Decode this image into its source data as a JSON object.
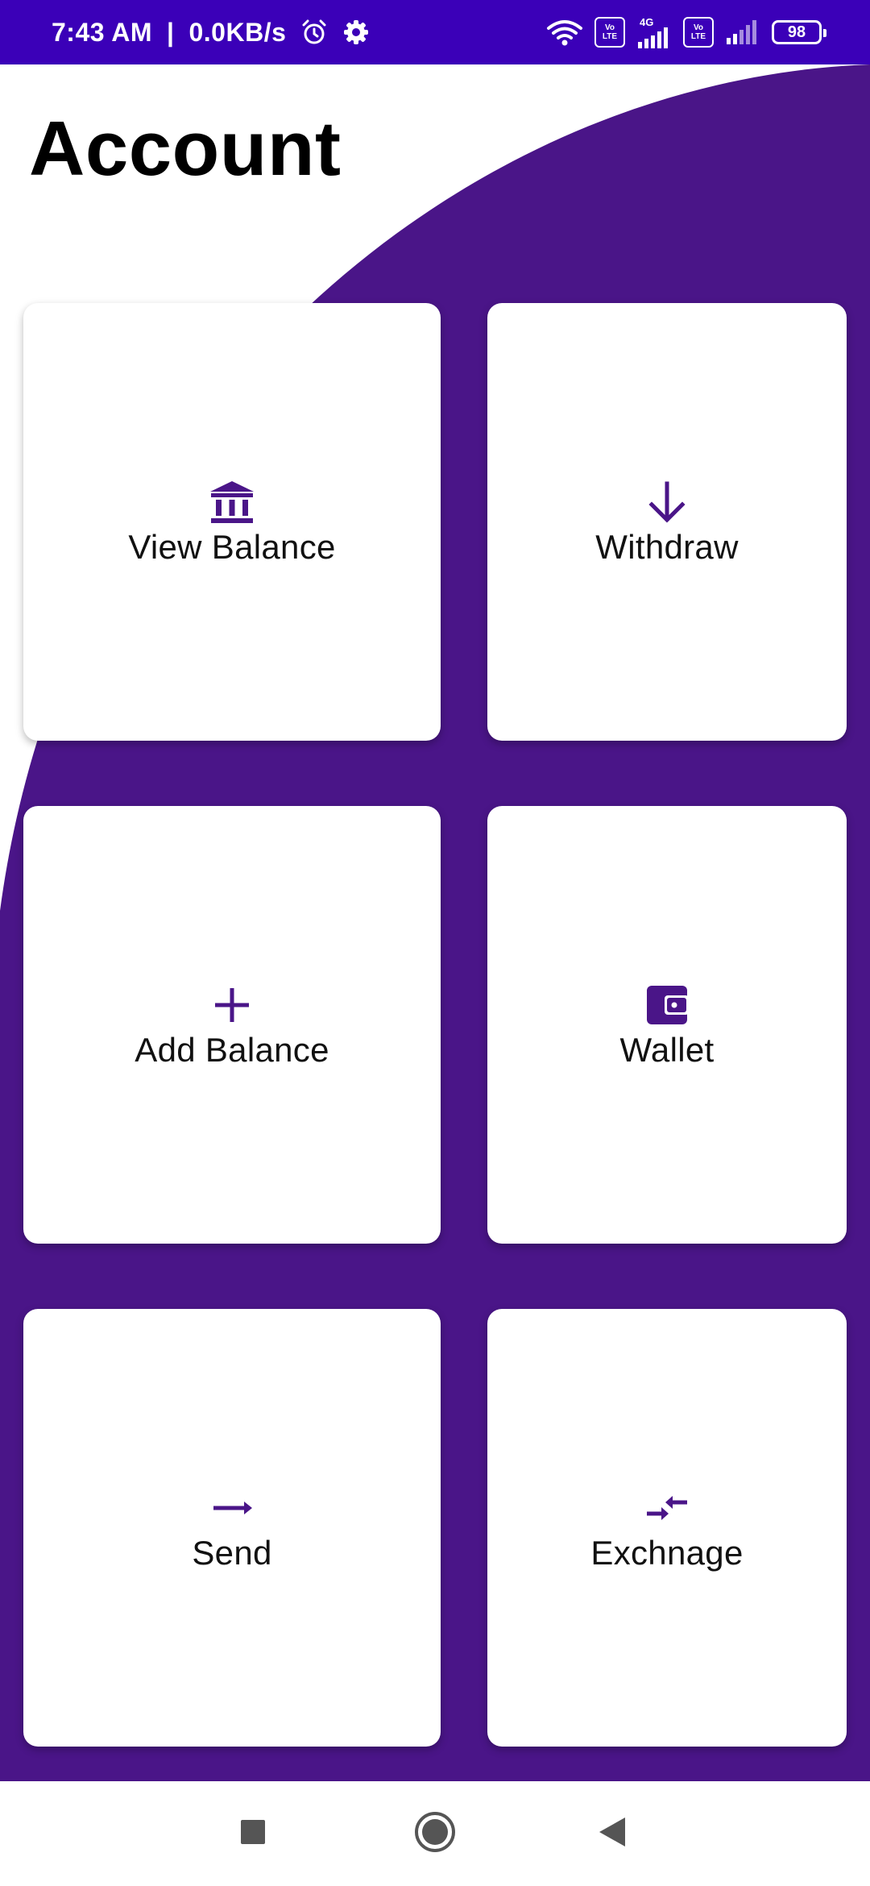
{
  "status_bar": {
    "time": "7:43 AM",
    "separator": "|",
    "net_speed": "0.0KB/s",
    "icons": [
      "alarm-icon",
      "gear-icon",
      "wifi-icon",
      "volte-icon",
      "signal-4g-icon",
      "volte-icon",
      "signal-icon",
      "battery-icon"
    ],
    "volte_top": "Vo",
    "volte_bottom": "LTE",
    "network_type": "4G",
    "battery_level": "98"
  },
  "page": {
    "title": "Account"
  },
  "tiles": [
    {
      "label": "View Balance",
      "icon": "bank-icon"
    },
    {
      "label": "Withdraw",
      "icon": "arrow-down-icon"
    },
    {
      "label": "Add Balance",
      "icon": "plus-icon"
    },
    {
      "label": "Wallet",
      "icon": "wallet-icon"
    },
    {
      "label": "Send",
      "icon": "arrow-right-icon"
    },
    {
      "label": "Exchnage",
      "icon": "compare-arrows-icon"
    }
  ],
  "nav_bar": {
    "icons": [
      "recents-square-icon",
      "home-circle-icon",
      "back-triangle-icon"
    ]
  },
  "colors": {
    "status_bar": "#3b00b8",
    "background_shape": "#4a1588",
    "icon_accent": "#4a1588",
    "tile": "#ffffff"
  }
}
